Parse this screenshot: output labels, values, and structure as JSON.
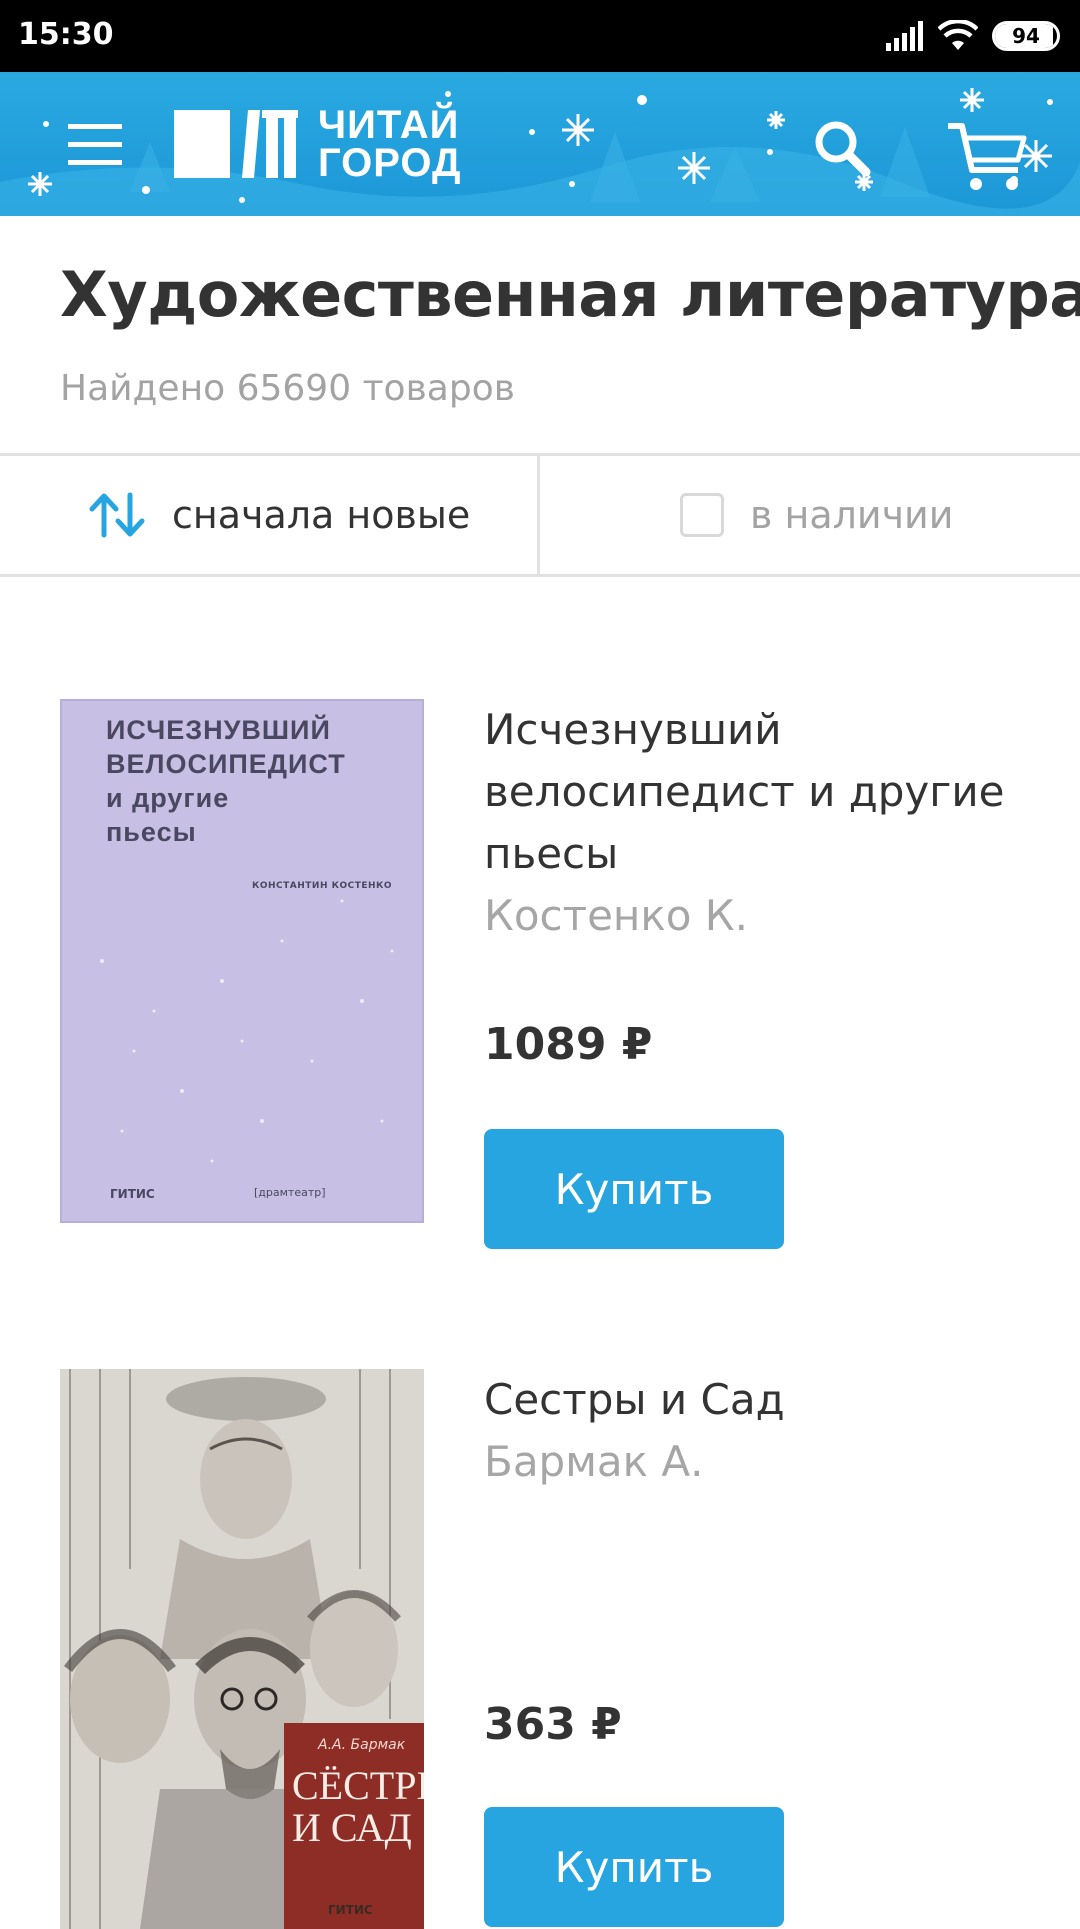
{
  "status_bar": {
    "time": "15:30",
    "battery": "94",
    "battery_level": 0.94,
    "icons": [
      "signal-icon",
      "wifi-icon",
      "battery-icon"
    ]
  },
  "header": {
    "logo_line1": "ЧИТАЙ",
    "logo_line2": "ГОРОД",
    "icons": [
      "menu-icon",
      "search-icon",
      "cart-icon"
    ],
    "background_color": "#1b97d6"
  },
  "category": {
    "title": "Художественная литература",
    "found_prefix": "Найдено",
    "found_count": "65690",
    "found_suffix": "товаров"
  },
  "filters": {
    "sort_label": "сначала новые",
    "in_stock_label": "в наличии",
    "in_stock_checked": false,
    "accent_color": "#27a5e0"
  },
  "products": [
    {
      "title_lines": [
        "Исчезнувший",
        "велосипедист и другие",
        "пьесы"
      ],
      "author": "Костенко К.",
      "price": "1089 ₽",
      "buy_label": "Купить",
      "cover": {
        "title_lines": [
          "ИСЧЕЗНУВШИЙ",
          "ВЕЛОСИПЕДИСТ",
          "и другие",
          "пьесы"
        ],
        "author": "КОНСТАНТИН КОСТЕНКО",
        "publisher": "ГИТИС",
        "series": "[драмтеатр]"
      }
    },
    {
      "title_lines": [
        "Сестры и Сад"
      ],
      "author": "Бармак А.",
      "price": "363 ₽",
      "buy_label": "Купить",
      "cover": {
        "author": "А.А. Бармак",
        "title_lines": [
          "СЁСТРЫ",
          "И САД"
        ],
        "publisher": "ГИТИС"
      }
    }
  ]
}
